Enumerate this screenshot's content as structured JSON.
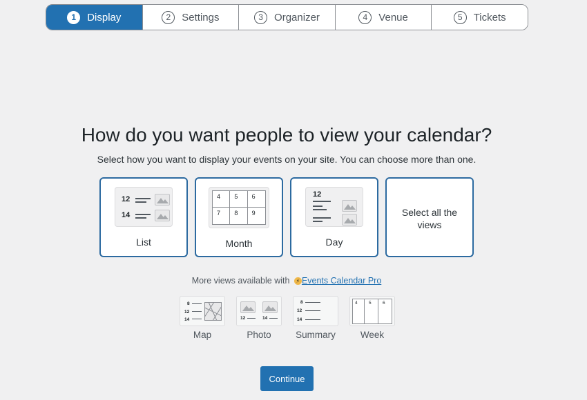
{
  "stepper": {
    "steps": [
      {
        "num": "1",
        "label": "Display",
        "active": true
      },
      {
        "num": "2",
        "label": "Settings"
      },
      {
        "num": "3",
        "label": "Organizer"
      },
      {
        "num": "4",
        "label": "Venue"
      },
      {
        "num": "5",
        "label": "Tickets"
      }
    ]
  },
  "heading": {
    "title": "How do you want people to view your calendar?",
    "subtitle": "Select how you want to display your events on your site. You can choose more than one."
  },
  "views": {
    "list": {
      "label": "List",
      "nums": [
        "12",
        "14"
      ]
    },
    "month": {
      "label": "Month",
      "nums": [
        "4",
        "5",
        "6",
        "7",
        "8",
        "9"
      ]
    },
    "day": {
      "label": "Day",
      "num": "12"
    },
    "all": {
      "label": "Select all the views"
    }
  },
  "pro": {
    "text": "More views available with",
    "link": "Events Calendar Pro",
    "bolt": "⚡",
    "views": {
      "map": {
        "label": "Map",
        "nums": [
          "8",
          "12",
          "14"
        ]
      },
      "photo": {
        "label": "Photo",
        "nums": [
          "12",
          "14"
        ]
      },
      "summary": {
        "label": "Summary",
        "nums": [
          "8",
          "12",
          "14"
        ]
      },
      "week": {
        "label": "Week",
        "nums": [
          "4",
          "5",
          "6"
        ]
      }
    }
  },
  "actions": {
    "continue_label": "Continue"
  },
  "colors": {
    "accent": "#2271b1",
    "card_border": "#2c6aa0",
    "background": "#f0f0f1"
  }
}
